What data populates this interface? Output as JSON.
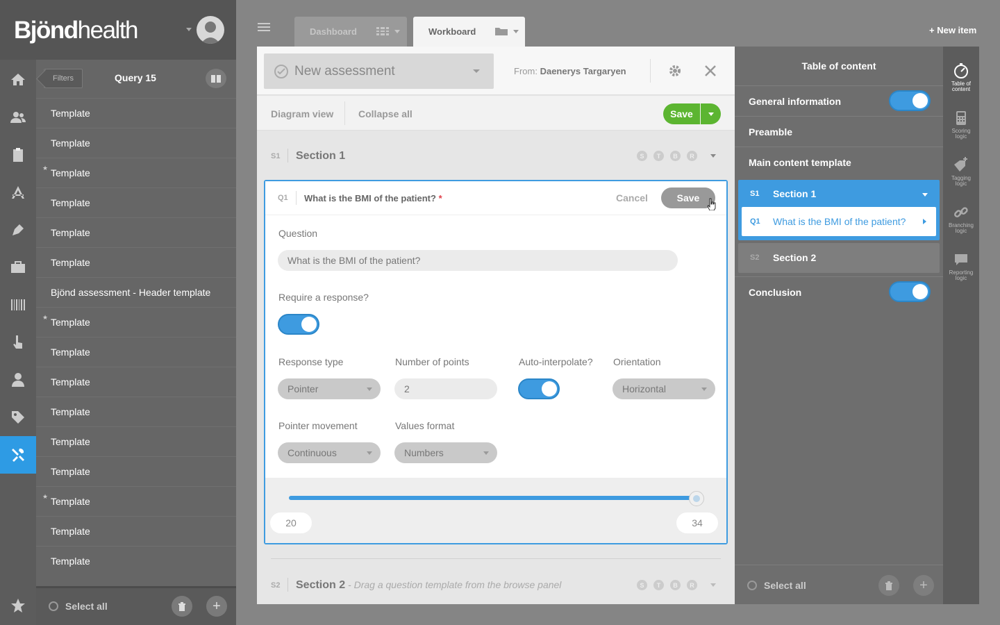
{
  "app": {
    "logo_bold": "Bjönd",
    "logo_thin": "health"
  },
  "rail": {
    "icons": [
      "home-icon",
      "users-icon",
      "clipboard-icon",
      "app-store-icon",
      "pen-icon",
      "briefcase-icon",
      "barcode-icon",
      "touch-icon",
      "person-icon",
      "tag-icon",
      "tools-icon",
      "star-icon"
    ],
    "active": "tools-icon"
  },
  "list_panel": {
    "filters_label": "Filters",
    "query_title": "Query 15",
    "items": [
      {
        "label": "Template",
        "starred": false
      },
      {
        "label": "Template",
        "starred": false
      },
      {
        "label": "Template",
        "starred": true
      },
      {
        "label": "Template",
        "starred": false
      },
      {
        "label": "Template",
        "starred": false
      },
      {
        "label": "Template",
        "starred": false
      },
      {
        "label": "Bjönd assessment - Header template",
        "starred": false
      },
      {
        "label": "Template",
        "starred": true
      },
      {
        "label": "Template",
        "starred": false
      },
      {
        "label": "Template",
        "starred": false
      },
      {
        "label": "Template",
        "starred": false
      },
      {
        "label": "Template",
        "starred": false
      },
      {
        "label": "Template",
        "starred": false
      },
      {
        "label": "Template",
        "starred": true
      },
      {
        "label": "Template",
        "starred": false
      },
      {
        "label": "Template",
        "starred": false
      }
    ],
    "select_all_label": "Select all"
  },
  "tabs": [
    {
      "label": "Dashboard",
      "active": false
    },
    {
      "label": "Workboard",
      "active": true
    }
  ],
  "new_item_label": "+ New item",
  "editor": {
    "assessment_title": "New assessment",
    "from_label": "From:",
    "from_name": "Daenerys Targaryen",
    "diagram_view": "Diagram view",
    "collapse_all": "Collapse all",
    "save_label": "Save",
    "section1": {
      "code": "S1",
      "title": "Section 1",
      "badges": [
        "S",
        "T",
        "B",
        "R"
      ]
    },
    "section2": {
      "code": "S2",
      "title": "Section 2",
      "hint": "- Drag a question template from the browse panel",
      "badges": [
        "S",
        "T",
        "B",
        "R"
      ]
    },
    "question": {
      "code": "Q1",
      "title": "What is the BMI of the patient?",
      "required_mark": "*",
      "cancel_label": "Cancel",
      "save_label": "Save",
      "question_label": "Question",
      "question_value": "What is the BMI of the patient?",
      "require_label": "Require a response?",
      "require_on": true,
      "response_type_label": "Response type",
      "response_type_value": "Pointer",
      "points_label": "Number of points",
      "points_value": "2",
      "interpolate_label": "Auto-interpolate?",
      "interpolate_on": true,
      "orientation_label": "Orientation",
      "orientation_value": "Horizontal",
      "movement_label": "Pointer movement",
      "movement_value": "Continuous",
      "format_label": "Values format",
      "format_value": "Numbers",
      "slider_min": "20",
      "slider_max": "34",
      "slider_fill_fraction": 1.0
    }
  },
  "toc": {
    "title": "Table of content",
    "general_info": "General information",
    "general_info_on": true,
    "preamble": "Preamble",
    "main_content": "Main content template",
    "section1_code": "S1",
    "section1_title": "Section 1",
    "q1_code": "Q1",
    "q1_title": "What is the BMI of the patient?",
    "section2_code": "S2",
    "section2_title": "Section 2",
    "conclusion": "Conclusion",
    "conclusion_on": true,
    "select_all_label": "Select all"
  },
  "side_rail": {
    "items": [
      {
        "icon": "compass-icon",
        "line1": "Table of",
        "line2": "content",
        "active": true
      },
      {
        "icon": "calculator-icon",
        "line1": "Scoring",
        "line2": "logic",
        "active": false
      },
      {
        "icon": "tag-plus-icon",
        "line1": "Tagging",
        "line2": "logic",
        "active": false
      },
      {
        "icon": "link-icon",
        "line1": "Branching",
        "line2": "logic",
        "active": false
      },
      {
        "icon": "speech-bubble-icon",
        "line1": "Reporting",
        "line2": "logic",
        "active": false
      }
    ]
  },
  "colors": {
    "accent": "#3e9be0",
    "save_green": "#5cb531",
    "active_rail": "#2e9be4"
  }
}
